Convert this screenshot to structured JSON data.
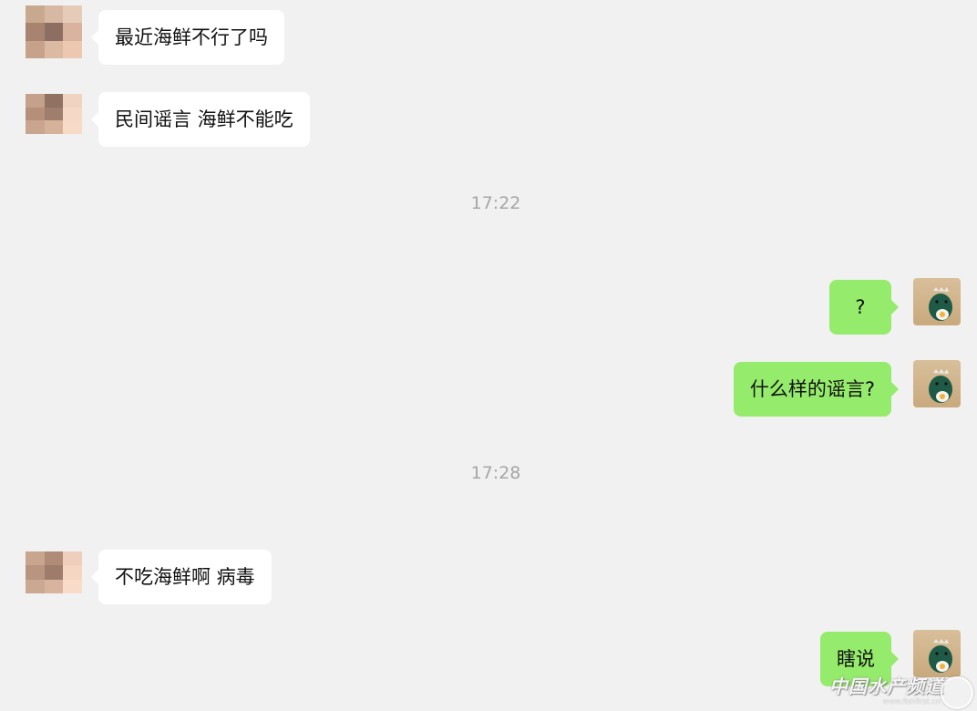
{
  "colors": {
    "background": "#f2f1f2",
    "incoming_bubble": "#ffffff",
    "outgoing_bubble": "#95eb6b",
    "timestamp_text": "#a6a6a6"
  },
  "contact_avatar_icon": "pixelated-avatar-icon",
  "self_avatar_icon": "green-dinosaur-avatar-icon",
  "messages": [
    {
      "side": "left",
      "text": "最近海鲜不行了吗"
    },
    {
      "side": "left",
      "text": "民间谣言 海鲜不能吃"
    },
    {
      "side": "right",
      "text": "?"
    },
    {
      "side": "right",
      "text": "什么样的谣言?"
    },
    {
      "side": "left",
      "text": "不吃海鲜啊 病毒"
    },
    {
      "side": "right",
      "text": "瞎说"
    }
  ],
  "timestamps": [
    "17:22",
    "17:28"
  ],
  "watermark": {
    "text": "中国水产频道",
    "sub": "www.fishfirst.cn"
  }
}
